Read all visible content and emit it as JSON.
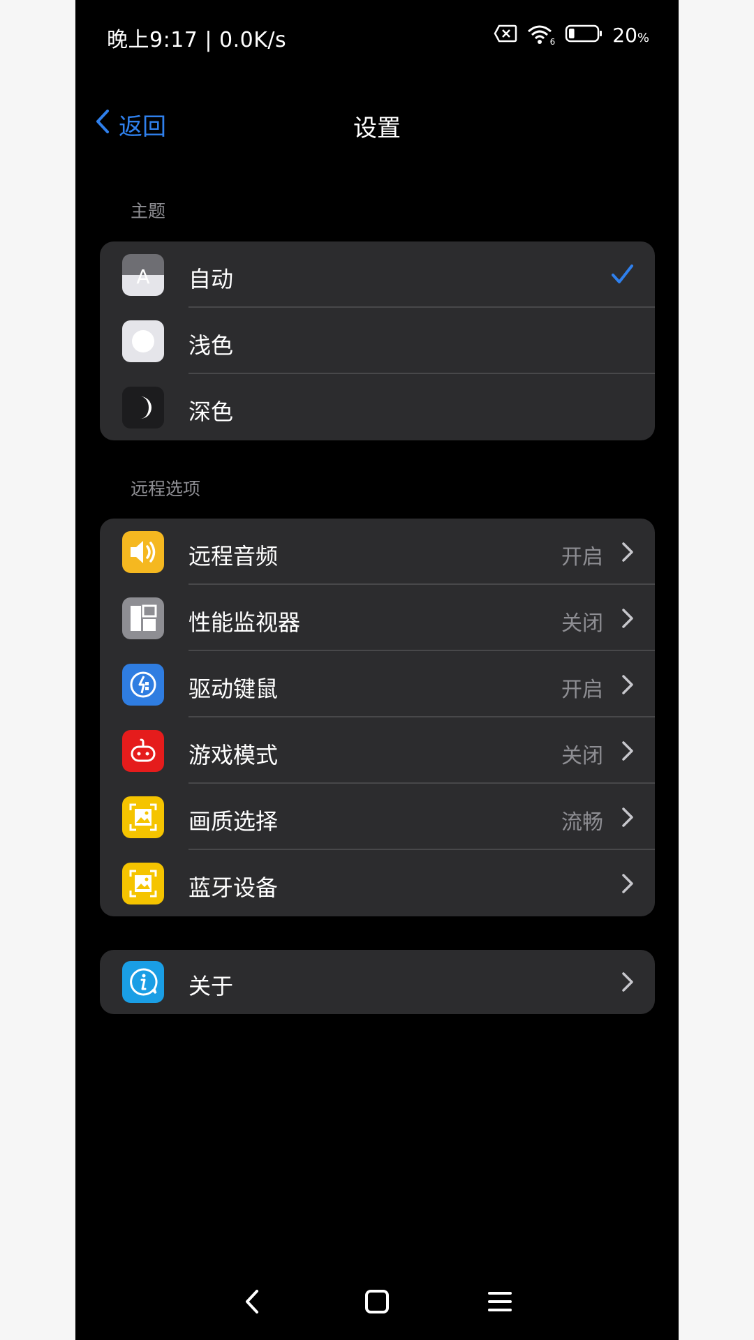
{
  "status_bar": {
    "time_speed": "晚上9:17 | 0.0K/s",
    "wifi_badge": "6",
    "battery_percent": "20",
    "battery_unit": "%",
    "battery_level": 0.2
  },
  "nav": {
    "back_label": "返回",
    "title": "设置"
  },
  "theme_section": {
    "header": "主题",
    "items": [
      {
        "label": "自动",
        "icon": "auto-theme-icon",
        "selected": true,
        "icon_glyph": "A"
      },
      {
        "label": "浅色",
        "icon": "light-theme-icon"
      },
      {
        "label": "深色",
        "icon": "moon-icon"
      }
    ]
  },
  "remote_section": {
    "header": "远程选项",
    "items": [
      {
        "label": "远程音频",
        "value": "开启",
        "icon": "speaker-icon",
        "color": "#f5b820"
      },
      {
        "label": "性能监视器",
        "value": "关闭",
        "icon": "layout-icon",
        "color": "#8e8e93"
      },
      {
        "label": "驱动键鼠",
        "value": "开启",
        "icon": "driver-icon",
        "color": "#2f7de1"
      },
      {
        "label": "游戏模式",
        "value": "关闭",
        "icon": "robot-icon",
        "color": "#e51c1c"
      },
      {
        "label": "画质选择",
        "value": "流畅",
        "icon": "image-icon",
        "color": "#f5c400"
      },
      {
        "label": "蓝牙设备",
        "value": "",
        "icon": "image-icon",
        "color": "#f5c400"
      }
    ]
  },
  "about_section": {
    "items": [
      {
        "label": "关于",
        "icon": "info-icon",
        "color": "#1a9ee5"
      }
    ]
  },
  "colors": {
    "accent": "#2f80ed",
    "background": "#000000",
    "group_bg": "#2c2c2e",
    "secondary_text": "#8e8e93"
  }
}
